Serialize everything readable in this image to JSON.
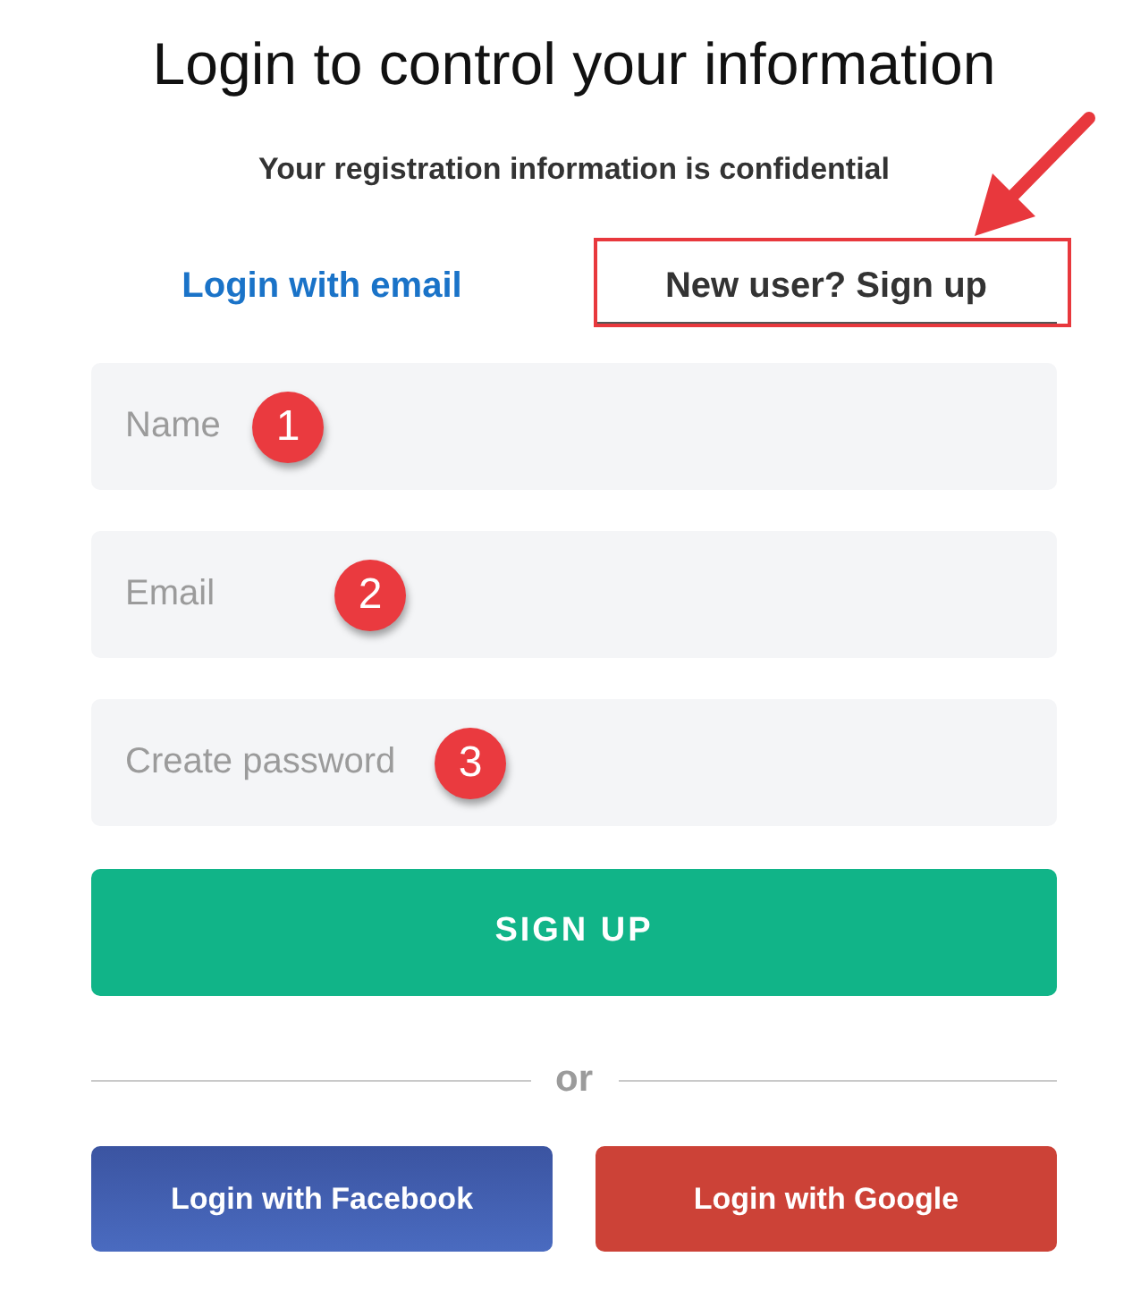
{
  "heading": {
    "title": "Login to control your information",
    "subtitle": "Your registration information is confidential"
  },
  "tabs": [
    {
      "label": "Login with email",
      "selected": false,
      "highlighted": false
    },
    {
      "label": "New user? Sign up",
      "selected": true,
      "highlighted": true
    }
  ],
  "fields": [
    {
      "placeholder": "Name",
      "marker": "1"
    },
    {
      "placeholder": "Email",
      "marker": "2"
    },
    {
      "placeholder": "Create password",
      "marker": "3"
    }
  ],
  "submit_button": {
    "label": "SIGN UP"
  },
  "divider": {
    "label": "or"
  },
  "social_buttons": [
    {
      "label": "Login with Facebook",
      "kind": "facebook"
    },
    {
      "label": "Login with Google",
      "kind": "google"
    }
  ]
}
